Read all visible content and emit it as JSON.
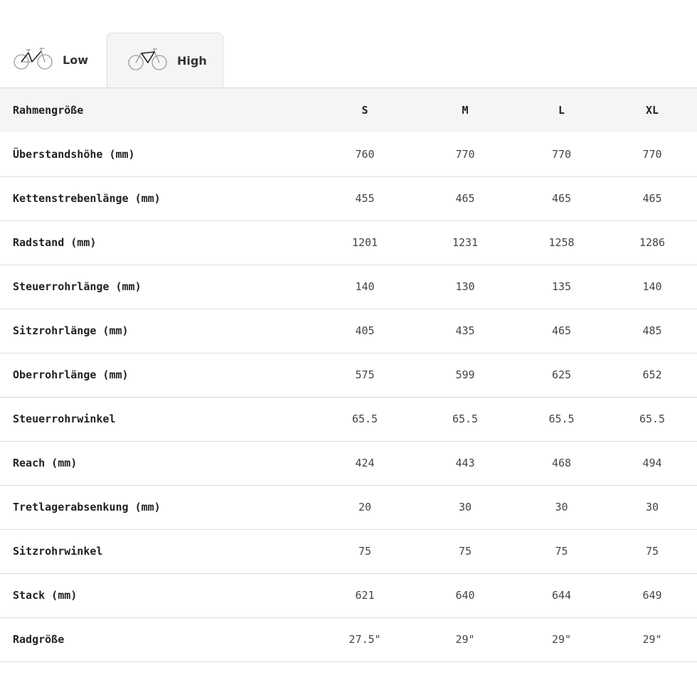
{
  "tabs": [
    {
      "label": "Low",
      "icon": "bike-low-frame-icon",
      "active": false
    },
    {
      "label": "High",
      "icon": "bike-high-frame-icon",
      "active": true
    }
  ],
  "table": {
    "header": {
      "label": "Rahmengröße",
      "sizes": [
        "S",
        "M",
        "L",
        "XL"
      ]
    },
    "rows": [
      {
        "label": "Überstandshöhe (mm)",
        "values": [
          "760",
          "770",
          "770",
          "770"
        ]
      },
      {
        "label": "Kettenstrebenlänge (mm)",
        "values": [
          "455",
          "465",
          "465",
          "465"
        ]
      },
      {
        "label": "Radstand (mm)",
        "values": [
          "1201",
          "1231",
          "1258",
          "1286"
        ]
      },
      {
        "label": "Steuerrohrlänge (mm)",
        "values": [
          "140",
          "130",
          "135",
          "140"
        ]
      },
      {
        "label": "Sitzrohrlänge (mm)",
        "values": [
          "405",
          "435",
          "465",
          "485"
        ]
      },
      {
        "label": "Oberrohrlänge (mm)",
        "values": [
          "575",
          "599",
          "625",
          "652"
        ]
      },
      {
        "label": "Steuerrohrwinkel",
        "values": [
          "65.5",
          "65.5",
          "65.5",
          "65.5"
        ]
      },
      {
        "label": "Reach (mm)",
        "values": [
          "424",
          "443",
          "468",
          "494"
        ]
      },
      {
        "label": "Tretlagerabsenkung (mm)",
        "values": [
          "20",
          "30",
          "30",
          "30"
        ]
      },
      {
        "label": "Sitzrohrwinkel",
        "values": [
          "75",
          "75",
          "75",
          "75"
        ]
      },
      {
        "label": "Stack (mm)",
        "values": [
          "621",
          "640",
          "644",
          "649"
        ]
      },
      {
        "label": "Radgröße",
        "values": [
          "27.5\"",
          "29\"",
          "29\"",
          "29\""
        ]
      }
    ]
  },
  "colors": {
    "header_bg": "#f5f5f5",
    "border": "#dcdcdc",
    "text": "#222222"
  }
}
